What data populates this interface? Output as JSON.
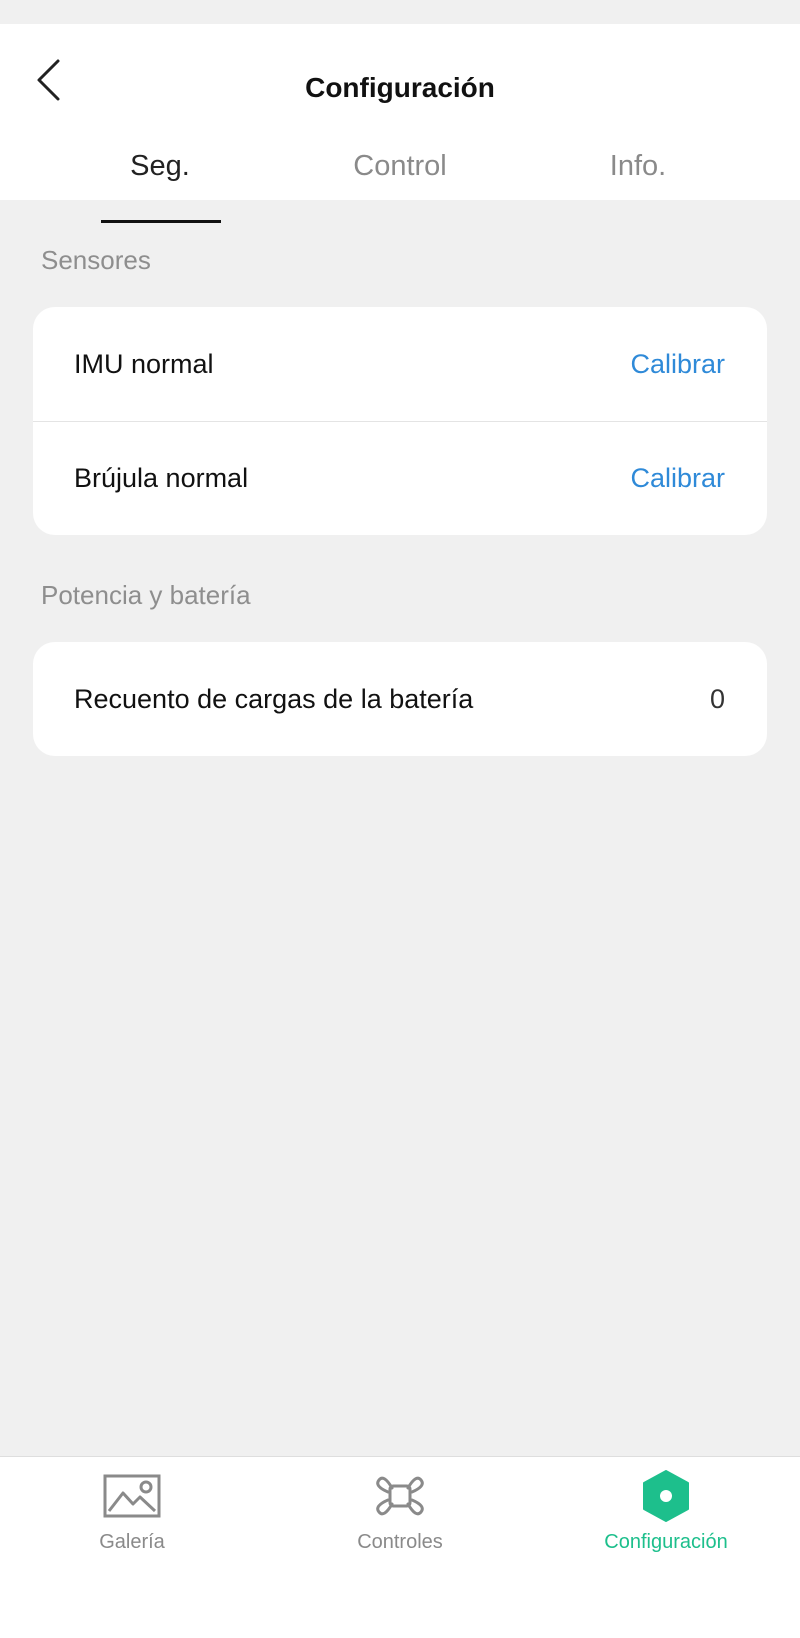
{
  "header": {
    "title": "Configuración",
    "back_icon": "chevron-left-icon"
  },
  "tabs": [
    {
      "label": "Seg.",
      "active": true
    },
    {
      "label": "Control",
      "active": false
    },
    {
      "label": "Info.",
      "active": false
    }
  ],
  "sections": [
    {
      "label": "Sensores",
      "rows": [
        {
          "label": "IMU normal",
          "action": "Calibrar"
        },
        {
          "label": "Brújula normal",
          "action": "Calibrar"
        }
      ]
    },
    {
      "label": "Potencia y batería",
      "rows": [
        {
          "label": "Recuento de cargas de la batería",
          "value": "0"
        }
      ]
    }
  ],
  "bottom_nav": [
    {
      "label": "Galería",
      "icon": "gallery-icon",
      "active": false
    },
    {
      "label": "Controles",
      "icon": "drone-icon",
      "active": false
    },
    {
      "label": "Configuración",
      "icon": "settings-hexagon-icon",
      "active": true
    }
  ],
  "colors": {
    "accent_blue": "#2f8ad8",
    "accent_green": "#1dbf8c",
    "background": "#f0f0f0"
  }
}
